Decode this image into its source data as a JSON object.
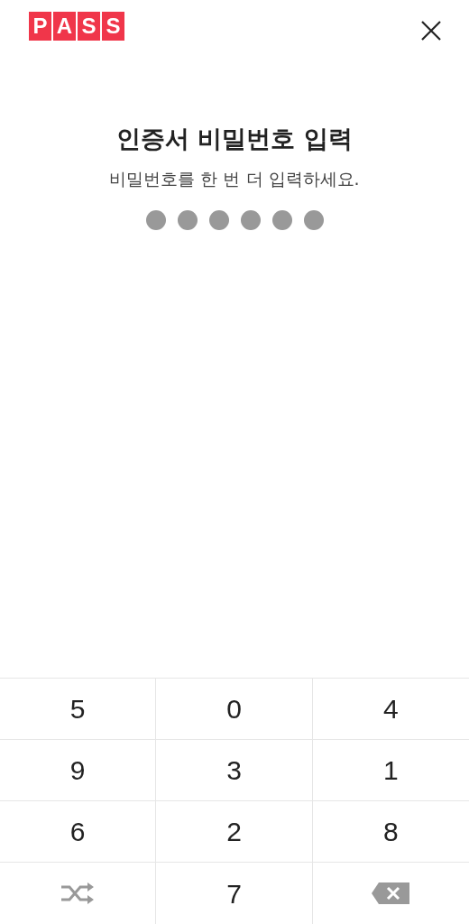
{
  "logo": {
    "letters": [
      "P",
      "A",
      "S",
      "S"
    ]
  },
  "title": "인증서 비밀번호 입력",
  "subtitle": "비밀번호를 한 번 더 입력하세요.",
  "pin_dots": [
    {
      "filled": true
    },
    {
      "filled": true
    },
    {
      "filled": true
    },
    {
      "filled": true
    },
    {
      "filled": true
    },
    {
      "filled": true
    }
  ],
  "keypad": [
    {
      "kind": "digit",
      "label": "5"
    },
    {
      "kind": "digit",
      "label": "0"
    },
    {
      "kind": "digit",
      "label": "4"
    },
    {
      "kind": "digit",
      "label": "9"
    },
    {
      "kind": "digit",
      "label": "3"
    },
    {
      "kind": "digit",
      "label": "1"
    },
    {
      "kind": "digit",
      "label": "6"
    },
    {
      "kind": "digit",
      "label": "2"
    },
    {
      "kind": "digit",
      "label": "8"
    },
    {
      "kind": "shuffle"
    },
    {
      "kind": "digit",
      "label": "7"
    },
    {
      "kind": "backspace"
    }
  ]
}
